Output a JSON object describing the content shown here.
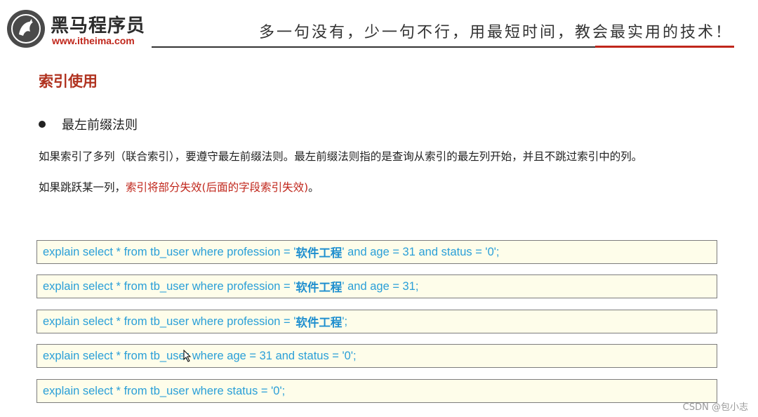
{
  "header": {
    "brand_name": "黑马程序员",
    "brand_url": "www.itheima.com",
    "slogan": "多一句没有，少一句不行，用最短时间，教会最实用的技术！"
  },
  "section_title": "索引使用",
  "bullet": "最左前缀法则",
  "paragraphs": {
    "p1": "如果索引了多列（联合索引），要遵守最左前缀法则。最左前缀法则指的是查询从索引的最左列开始，并且不跳过索引中的列。",
    "p2_prefix": "如果跳跃某一列，",
    "p2_emphasis": "索引将部分失效(后面的字段索引失效)",
    "p2_suffix": "。"
  },
  "queries": [
    {
      "pre": "explain select * from tb_user where profession = '",
      "cn": "软件工程",
      "post": "' and age = 31 and status = '0';"
    },
    {
      "pre": "explain select * from tb_user where profession = '",
      "cn": "软件工程",
      "post": "' and age = 31;"
    },
    {
      "pre": "explain select * from tb_user where profession = '",
      "cn": "软件工程",
      "post": "';"
    },
    {
      "pre": "explain select * from tb_user where age = 31 and status = '0';",
      "cn": "",
      "post": ""
    },
    {
      "pre": "explain select * from tb_user where status = '0';",
      "cn": "",
      "post": ""
    }
  ],
  "watermark": "CSDN @包小志",
  "colors": {
    "accent_red": "#c0261b",
    "code_blue": "#2a9fd8",
    "code_bg": "#fefdea"
  }
}
